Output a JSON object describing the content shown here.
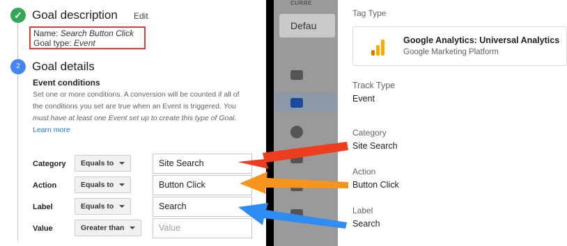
{
  "goal_description": {
    "title": "Goal description",
    "edit_label": "Edit",
    "name_prefix": "Name: ",
    "name_value": "Search Button Click",
    "type_prefix": "Goal type: ",
    "type_value": "Event"
  },
  "goal_details": {
    "step_number": "2",
    "title": "Goal details",
    "section_title": "Event conditions",
    "helper_text": "Set one or more conditions. A conversion will be counted if all of the conditions you set are true when an Event is triggered. ",
    "helper_italic": "You must have at least one Event set up to create this type of Goal.",
    "learn_more": "Learn more"
  },
  "conditions": [
    {
      "label": "Category",
      "operator": "Equals to",
      "value": "Site Search"
    },
    {
      "label": "Action",
      "operator": "Equals to",
      "value": "Button Click"
    },
    {
      "label": "Label",
      "operator": "Equals to",
      "value": "Search"
    },
    {
      "label": "Value",
      "operator": "Greater than",
      "placeholder": "Value"
    }
  ],
  "gtm_middle": {
    "header": "CURRE",
    "card_label": "Defau"
  },
  "tag_config": {
    "tag_type_label": "Tag Type",
    "tag_name": "Google Analytics: Universal Analytics",
    "tag_platform": "Google Marketing Platform",
    "track_type_label": "Track Type",
    "track_type_value": "Event",
    "category_label": "Category",
    "category_value": "Site Search",
    "action_label": "Action",
    "action_value": "Button Click",
    "label_label": "Label",
    "label_value": "Search"
  },
  "colors": {
    "highlight_red": "#e53935",
    "arrow_red": "#ee3d1e",
    "arrow_orange": "#f7941d",
    "arrow_blue": "#2f8cf2",
    "step_done": "#34a853",
    "step_active": "#4285f4"
  }
}
